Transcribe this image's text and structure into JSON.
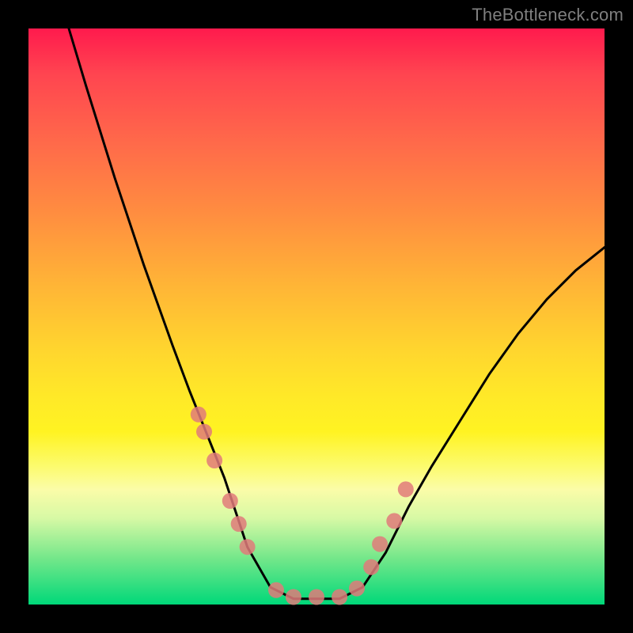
{
  "watermark": "TheBottleneck.com",
  "chart_data": {
    "type": "line",
    "title": "",
    "xlabel": "",
    "ylabel": "",
    "xlim": [
      0,
      100
    ],
    "ylim": [
      0,
      100
    ],
    "series": [
      {
        "name": "bottleneck-curve",
        "x": [
          7,
          10,
          15,
          20,
          25,
          28,
          30,
          32,
          34,
          36,
          38,
          42,
          46,
          50,
          54,
          58,
          62,
          66,
          70,
          75,
          80,
          85,
          90,
          95,
          100
        ],
        "values": [
          100,
          90,
          74,
          59,
          45,
          37,
          32,
          27,
          22,
          16,
          10,
          3,
          1,
          1,
          1,
          3,
          9,
          17,
          24,
          32,
          40,
          47,
          53,
          58,
          62
        ]
      }
    ],
    "markers": {
      "name": "highlight-dots",
      "x": [
        29.5,
        30.5,
        32.3,
        35.0,
        36.5,
        38.0,
        43.0,
        46.0,
        50.0,
        54.0,
        57.0,
        59.5,
        61.0,
        63.5,
        65.5
      ],
      "values": [
        33.0,
        30.0,
        25.0,
        18.0,
        14.0,
        10.0,
        2.5,
        1.3,
        1.3,
        1.3,
        2.8,
        6.5,
        10.5,
        14.5,
        20.0
      ]
    },
    "gradient_stops": [
      {
        "pos": 0,
        "color": "#ff1a4d"
      },
      {
        "pos": 20,
        "color": "#ff6a4a"
      },
      {
        "pos": 45,
        "color": "#ffb636"
      },
      {
        "pos": 70,
        "color": "#fff322"
      },
      {
        "pos": 85,
        "color": "#d7f9a5"
      },
      {
        "pos": 100,
        "color": "#00d879"
      }
    ]
  }
}
